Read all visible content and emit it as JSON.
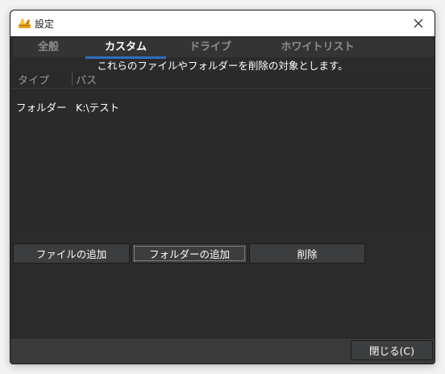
{
  "window": {
    "title": "設定"
  },
  "tabs": [
    {
      "label": "全般",
      "active": false
    },
    {
      "label": "カスタム",
      "active": true
    },
    {
      "label": "ドライブ",
      "active": false
    },
    {
      "label": "ホワイトリスト",
      "active": false
    }
  ],
  "custom": {
    "description": "これらのファイルやフォルダーを削除の対象とします。",
    "columns": [
      "タイプ",
      "パス"
    ],
    "rows": [
      {
        "type": "フォルダー",
        "path": "K:\\テスト"
      }
    ],
    "buttons": {
      "add_file": "ファイルの追加",
      "add_folder": "フォルダーの追加",
      "delete": "削除"
    }
  },
  "footer": {
    "close_label": "閉じる(C)"
  },
  "colors": {
    "accent": "#2f6fbd",
    "background": "#2b2b2b"
  },
  "icons": {
    "app": "broom-icon",
    "close": "close-icon"
  }
}
